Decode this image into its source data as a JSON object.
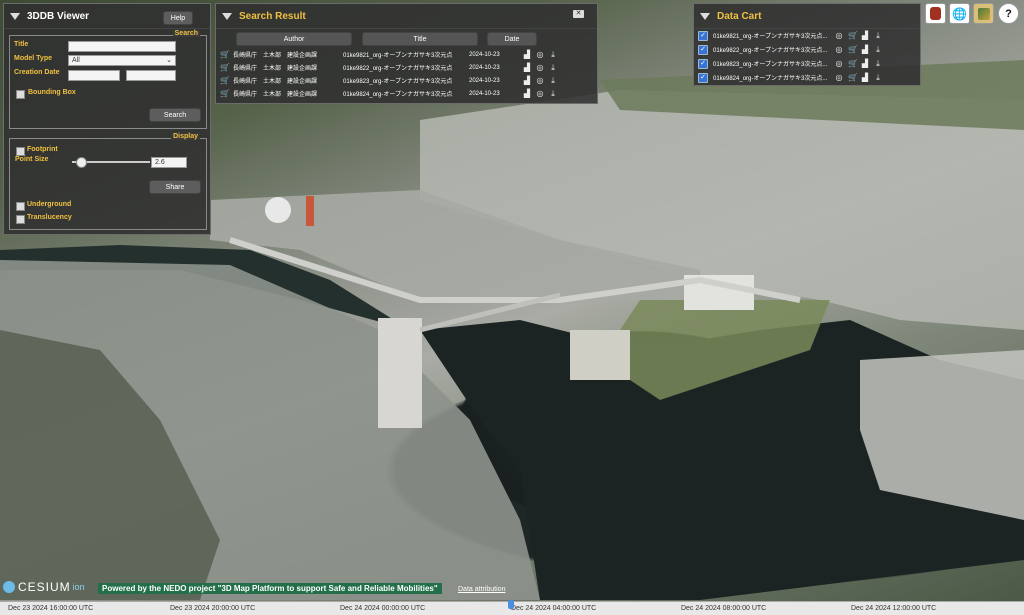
{
  "viewer_panel": {
    "title": "3DDB Viewer",
    "help_label": "Help",
    "search_group": "Search",
    "title_label": "Title",
    "title_value": "",
    "model_type_label": "Model Type",
    "model_type_value": "All",
    "creation_date_label": "Creation Date",
    "bounding_box_label": "Bounding Box",
    "search_button": "Search",
    "display_group": "Display",
    "footprint_label": "Footprint",
    "point_size_label": "Point Size",
    "point_size_value": "2.6",
    "point_size_fraction": 0.1,
    "share_button": "Share",
    "underground_label": "Underground",
    "translucency_label": "Translucency"
  },
  "search_result": {
    "title": "Search Result",
    "close_icon": "close-icon",
    "columns": [
      "Author",
      "Title",
      "Date"
    ],
    "rows": [
      {
        "author": "長崎県庁　土木部　建設企画課",
        "title": "01ke9821_org-オープンナガサキ3次元点",
        "date": "2024-10-23"
      },
      {
        "author": "長崎県庁　土木部　建設企画課",
        "title": "01ke9822_org-オープンナガサキ3次元点",
        "date": "2024-10-23"
      },
      {
        "author": "長崎県庁　土木部　建設企画課",
        "title": "01ke9823_org-オープンナガサキ3次元点",
        "date": "2024-10-23"
      },
      {
        "author": "長崎県庁　土木部　建設企画課",
        "title": "01ke9824_org-オープンナガサキ3次元点",
        "date": "2024-10-23"
      }
    ]
  },
  "data_cart": {
    "title": "Data Cart",
    "items": [
      {
        "label": "01ke9821_org-オープンナガサキ3次元点..."
      },
      {
        "label": "01ke9822_org-オープンナガサキ3次元点..."
      },
      {
        "label": "01ke9823_org-オープンナガサキ3次元点..."
      },
      {
        "label": "01ke9824_org-オープンナガサキ3次元点..."
      }
    ]
  },
  "top_icons": [
    "badge-icon",
    "globe-icon",
    "map-layers-icon",
    "help-icon"
  ],
  "help_glyph": "?",
  "footer": {
    "cesium_brand": "CESIUM",
    "cesium_suffix": "ion",
    "nedo_text": "Powered by the NEDO project \"3D Map Platform to support Safe and Reliable Mobilities\"",
    "data_attribution": "Data attribution"
  },
  "timeline": {
    "ticks": [
      "Dec 23 2024 16:00:00 UTC",
      "Dec 23 2024 20:00:00 UTC",
      "Dec 24 2024 00:00:00 UTC",
      "Dec 24 2024 04:00:00 UTC",
      "Dec 24 2024 08:00:00 UTC",
      "Dec 24 2024 12:00:00 UTC"
    ]
  },
  "colors": {
    "accent": "#f0c040",
    "cart_check": "#3a73d6"
  }
}
